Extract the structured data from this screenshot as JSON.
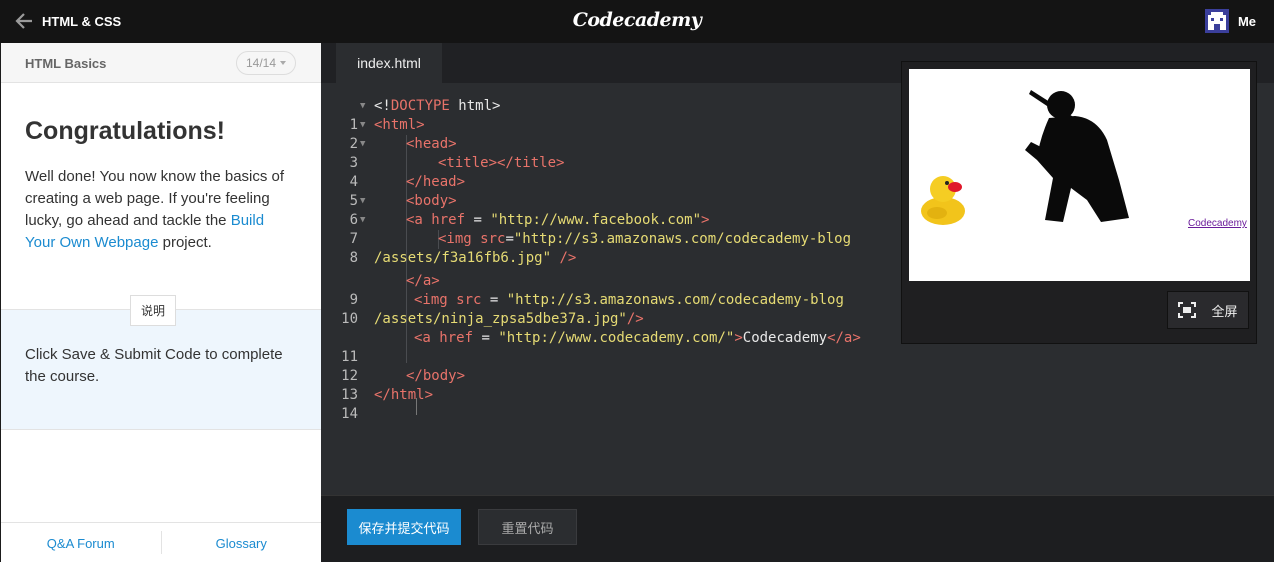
{
  "header": {
    "back_icon": "arrow-left-icon",
    "course_title": "HTML & CSS",
    "logo_text": "Codecademy",
    "user_label": "Me",
    "avatar_icon": "pixel-avatar-icon"
  },
  "lesson": {
    "name": "HTML Basics",
    "progress": "14/14",
    "heading": "Congratulations!",
    "body_before_link": "Well done! You now know the basics of creating a web page. If you're feeling lucky, go ahead and tackle the ",
    "body_link": "Build Your Own Webpage",
    "body_after_link": " project.",
    "instructions_label": "说明",
    "instructions_text": "Click Save & Submit Code to complete the course.",
    "footer_links": [
      "Q&A Forum",
      "Glossary"
    ]
  },
  "editor": {
    "tab_label": "index.html",
    "lines": [
      {
        "n": "1",
        "fold": true
      },
      {
        "n": "2",
        "fold": true
      },
      {
        "n": "3",
        "fold": true
      },
      {
        "n": "4",
        "fold": false
      },
      {
        "n": "5",
        "fold": false
      },
      {
        "n": "6",
        "fold": true
      },
      {
        "n": "7",
        "fold": true
      },
      {
        "n": "8",
        "fold": false
      },
      {
        "n": "9",
        "fold": false
      },
      {
        "n": "10",
        "fold": false
      },
      {
        "n": "11",
        "fold": false
      },
      {
        "n": "12",
        "fold": false
      },
      {
        "n": "13",
        "fold": false
      },
      {
        "n": "14",
        "fold": false
      }
    ],
    "code": {
      "l1": [
        "<!",
        "DOCTYPE",
        " html>"
      ],
      "l2": "<html>",
      "l3": "<head>",
      "l4": "<title></title>",
      "l5": "</head>",
      "l6": "<body>",
      "l7_tag": "<a href",
      "l7_eq": " = ",
      "l7_str": "\"http://www.facebook.com\"",
      "l7_end": ">",
      "l8_tag": "<img src",
      "l8_eq": "=",
      "l8_str": "\"http://s3.amazonaws.com/codecademy-blog",
      "l8b_str": "/assets/f3a16fb6.jpg\"",
      "l8b_end": " />",
      "l9": "</a>",
      "l10_tag": "<img src",
      "l10_eq": " = ",
      "l10_str": "\"http://s3.amazonaws.com/codecademy-blog",
      "l10b_str": "/assets/ninja_zpsa5dbe37a.jpg\"",
      "l10b_end": "/>",
      "l11_tag": "<a href",
      "l11_eq": " = ",
      "l11_str": "\"http://www.codecademy.com/\"",
      "l11_gt": ">",
      "l11_text": "Codecademy",
      "l11_close": "</a>",
      "l13": "</body>",
      "l14": "</html>"
    }
  },
  "preview": {
    "link_text": "Codecademy",
    "duck_image": "rubber-duck-image",
    "ninja_image": "ninja-silhouette-image",
    "fullscreen_label": "全屏",
    "fullscreen_icon": "fullscreen-icon"
  },
  "actions": {
    "submit_label": "保存并提交代码",
    "reset_label": "重置代码"
  },
  "colors": {
    "accent": "#1b8bd0",
    "editor_bg": "#2b2d30",
    "tag": "#e8736a",
    "string": "#e6db74"
  }
}
